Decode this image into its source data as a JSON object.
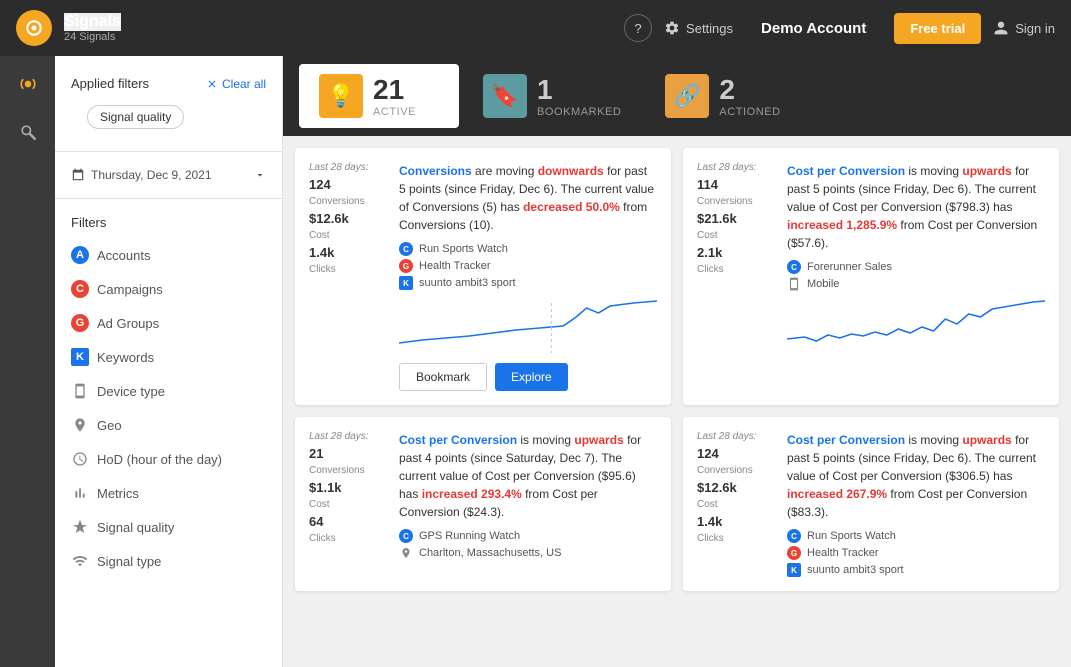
{
  "nav": {
    "logo_label": "Signals",
    "subtitle": "24 Signals",
    "help_label": "?",
    "settings_label": "Settings",
    "demo_account": "Demo Account",
    "free_trial": "Free trial",
    "signin": "Sign in"
  },
  "status_tabs": [
    {
      "id": "active",
      "icon": "💡",
      "icon_bg": "#f5a623",
      "number": "21",
      "label": "Active",
      "active": true
    },
    {
      "id": "bookmarked",
      "icon": "🔖",
      "icon_bg": "#5c9ca0",
      "number": "1",
      "label": "Bookmarked",
      "active": false
    },
    {
      "id": "actioned",
      "icon": "🔗",
      "icon_bg": "#e8a040",
      "number": "2",
      "label": "Actioned",
      "active": false
    }
  ],
  "sidebar": {
    "icons": [
      "signal",
      "telescope"
    ]
  },
  "left_panel": {
    "applied_filters": "Applied filters",
    "clear_all": "Clear all",
    "signal_quality": "Signal quality",
    "date": "Thursday, Dec 9, 2021",
    "filters_label": "Filters",
    "filters": [
      {
        "id": "accounts",
        "letter": "A",
        "color": "#1a73e8",
        "label": "Accounts"
      },
      {
        "id": "campaigns",
        "letter": "C",
        "color": "#ea4335",
        "label": "Campaigns"
      },
      {
        "id": "ad-groups",
        "letter": "G",
        "color": "#ea4335",
        "label": "Ad Groups"
      },
      {
        "id": "keywords",
        "letter": "K",
        "color": "#1a73e8",
        "label": "Keywords"
      },
      {
        "id": "device-type",
        "letter": "D",
        "color": "#888",
        "label": "Device type",
        "icon": "device"
      },
      {
        "id": "geo",
        "letter": "G",
        "color": "#888",
        "label": "Geo",
        "icon": "geo"
      },
      {
        "id": "hod",
        "letter": "H",
        "color": "#888",
        "label": "HoD (hour of the day)",
        "icon": "clock"
      },
      {
        "id": "metrics",
        "letter": "M",
        "color": "#888",
        "label": "Metrics",
        "icon": "chart"
      },
      {
        "id": "signal-quality",
        "letter": "S",
        "color": "#888",
        "label": "Signal quality",
        "icon": "trophy"
      },
      {
        "id": "signal-type",
        "letter": "T",
        "color": "#888",
        "label": "Signal type",
        "icon": "signal"
      }
    ]
  },
  "cards": [
    {
      "id": "card1",
      "last_days": "Last 28 days:",
      "stats": [
        {
          "value": "124",
          "label": "Conversions"
        },
        {
          "value": "$12.6k",
          "label": "Cost"
        },
        {
          "value": "1.4k",
          "label": "Clicks"
        }
      ],
      "metric": "Conversions",
      "direction": "downwards",
      "detail": "for past 5 points (since Friday, Dec 6). The current value of Conversions (5) has decreased 50.0% from Conversions (10).",
      "decrease_pct": "50.0%",
      "tags": [
        {
          "type": "c",
          "label": "Run Sports Watch"
        },
        {
          "type": "g",
          "label": "Health Tracker"
        },
        {
          "type": "k",
          "label": "suunto ambit3 sport"
        }
      ],
      "show_actions": true
    },
    {
      "id": "card2",
      "last_days": "Last 28 days:",
      "stats": [
        {
          "value": "114",
          "label": "Conversions"
        },
        {
          "value": "$21.6k",
          "label": "Cost"
        },
        {
          "value": "2.1k",
          "label": "Clicks"
        }
      ],
      "metric": "Cost per Conversion",
      "direction": "upwards",
      "detail": "for past 5 points (since Friday, Dec 6). The current value of Cost per Conversion ($798.3) has increased 1,285.9% from Cost per Conversion ($57.6).",
      "increase_pct": "1,285.9%",
      "tags": [
        {
          "type": "c",
          "label": "Forerunner Sales"
        },
        {
          "type": "mobile",
          "label": "Mobile"
        }
      ],
      "show_actions": false
    },
    {
      "id": "card3",
      "last_days": "Last 28 days:",
      "stats": [
        {
          "value": "21",
          "label": "Conversions"
        },
        {
          "value": "$1.1k",
          "label": "Cost"
        },
        {
          "value": "64",
          "label": "Clicks"
        }
      ],
      "metric": "Cost per Conversion",
      "direction": "upwards",
      "detail": "for past 4 points (since Saturday, Dec 7). The current value of Cost per Conversion ($95.6) has increased 293.4% from Cost per Conversion ($24.3).",
      "increase_pct": "293.4%",
      "tags": [
        {
          "type": "c",
          "label": "GPS Running Watch"
        },
        {
          "type": "geo",
          "label": "Charlton, Massachusetts, US"
        }
      ],
      "show_actions": false
    },
    {
      "id": "card4",
      "last_days": "Last 28 days:",
      "stats": [
        {
          "value": "124",
          "label": "Conversions"
        },
        {
          "value": "$12.6k",
          "label": "Cost"
        },
        {
          "value": "1.4k",
          "label": "Clicks"
        }
      ],
      "metric": "Cost per Conversion",
      "direction": "upwards",
      "detail": "for past 5 points (since Friday, Dec 6). The current value of Cost per Conversion ($306.5) has increased 267.9% from Cost per Conversion ($83.3).",
      "increase_pct": "267.9%",
      "tags": [
        {
          "type": "c",
          "label": "Run Sports Watch"
        },
        {
          "type": "g",
          "label": "Health Tracker"
        },
        {
          "type": "k",
          "label": "suunto ambit3 sport"
        }
      ],
      "show_actions": false
    }
  ],
  "buttons": {
    "bookmark": "Bookmark",
    "explore": "Explore"
  }
}
